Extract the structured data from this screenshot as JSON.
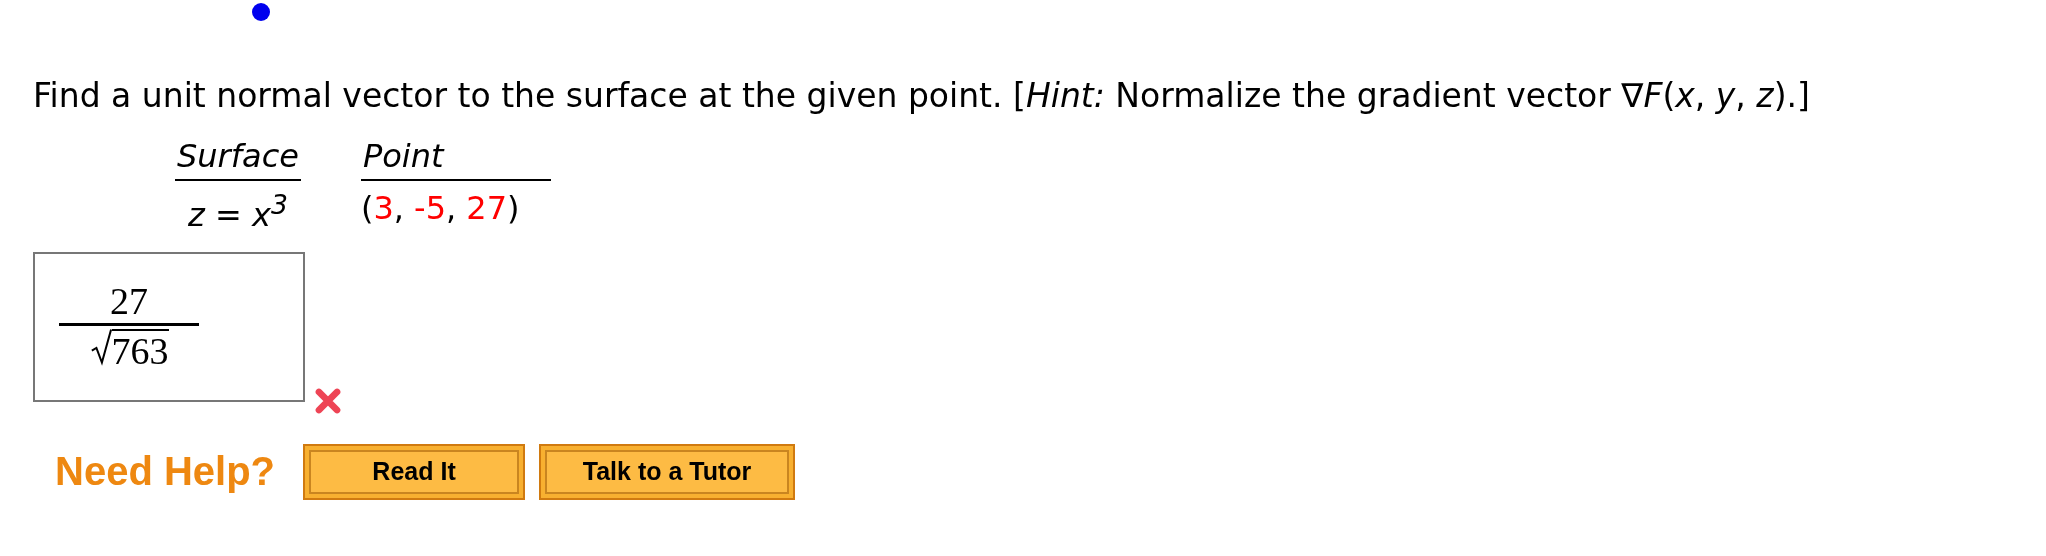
{
  "question": "Find a unit normal vector to the surface at the given point. [*Hint:* Normalize the gradient vector  ∇*F*(*x*, *y*, *z*).]",
  "table": {
    "headers": [
      "Surface",
      "Point"
    ],
    "surface": "z = x$^{3}$",
    "point": [
      {
        "text": "(",
        "highlighted": false
      },
      {
        "text": "3",
        "highlighted": true
      },
      {
        "text": ", ",
        "highlighted": false
      },
      {
        "text": "-5",
        "highlighted": true
      },
      {
        "text": ", ",
        "highlighted": false
      },
      {
        "text": "27",
        "highlighted": true
      },
      {
        "text": ")",
        "highlighted": false
      }
    ]
  },
  "answer": {
    "numerator": "27",
    "radicand": "763",
    "correct": false
  },
  "help": {
    "label": "Need Help?",
    "buttons": [
      "Read It",
      "Talk to a Tutor"
    ]
  }
}
